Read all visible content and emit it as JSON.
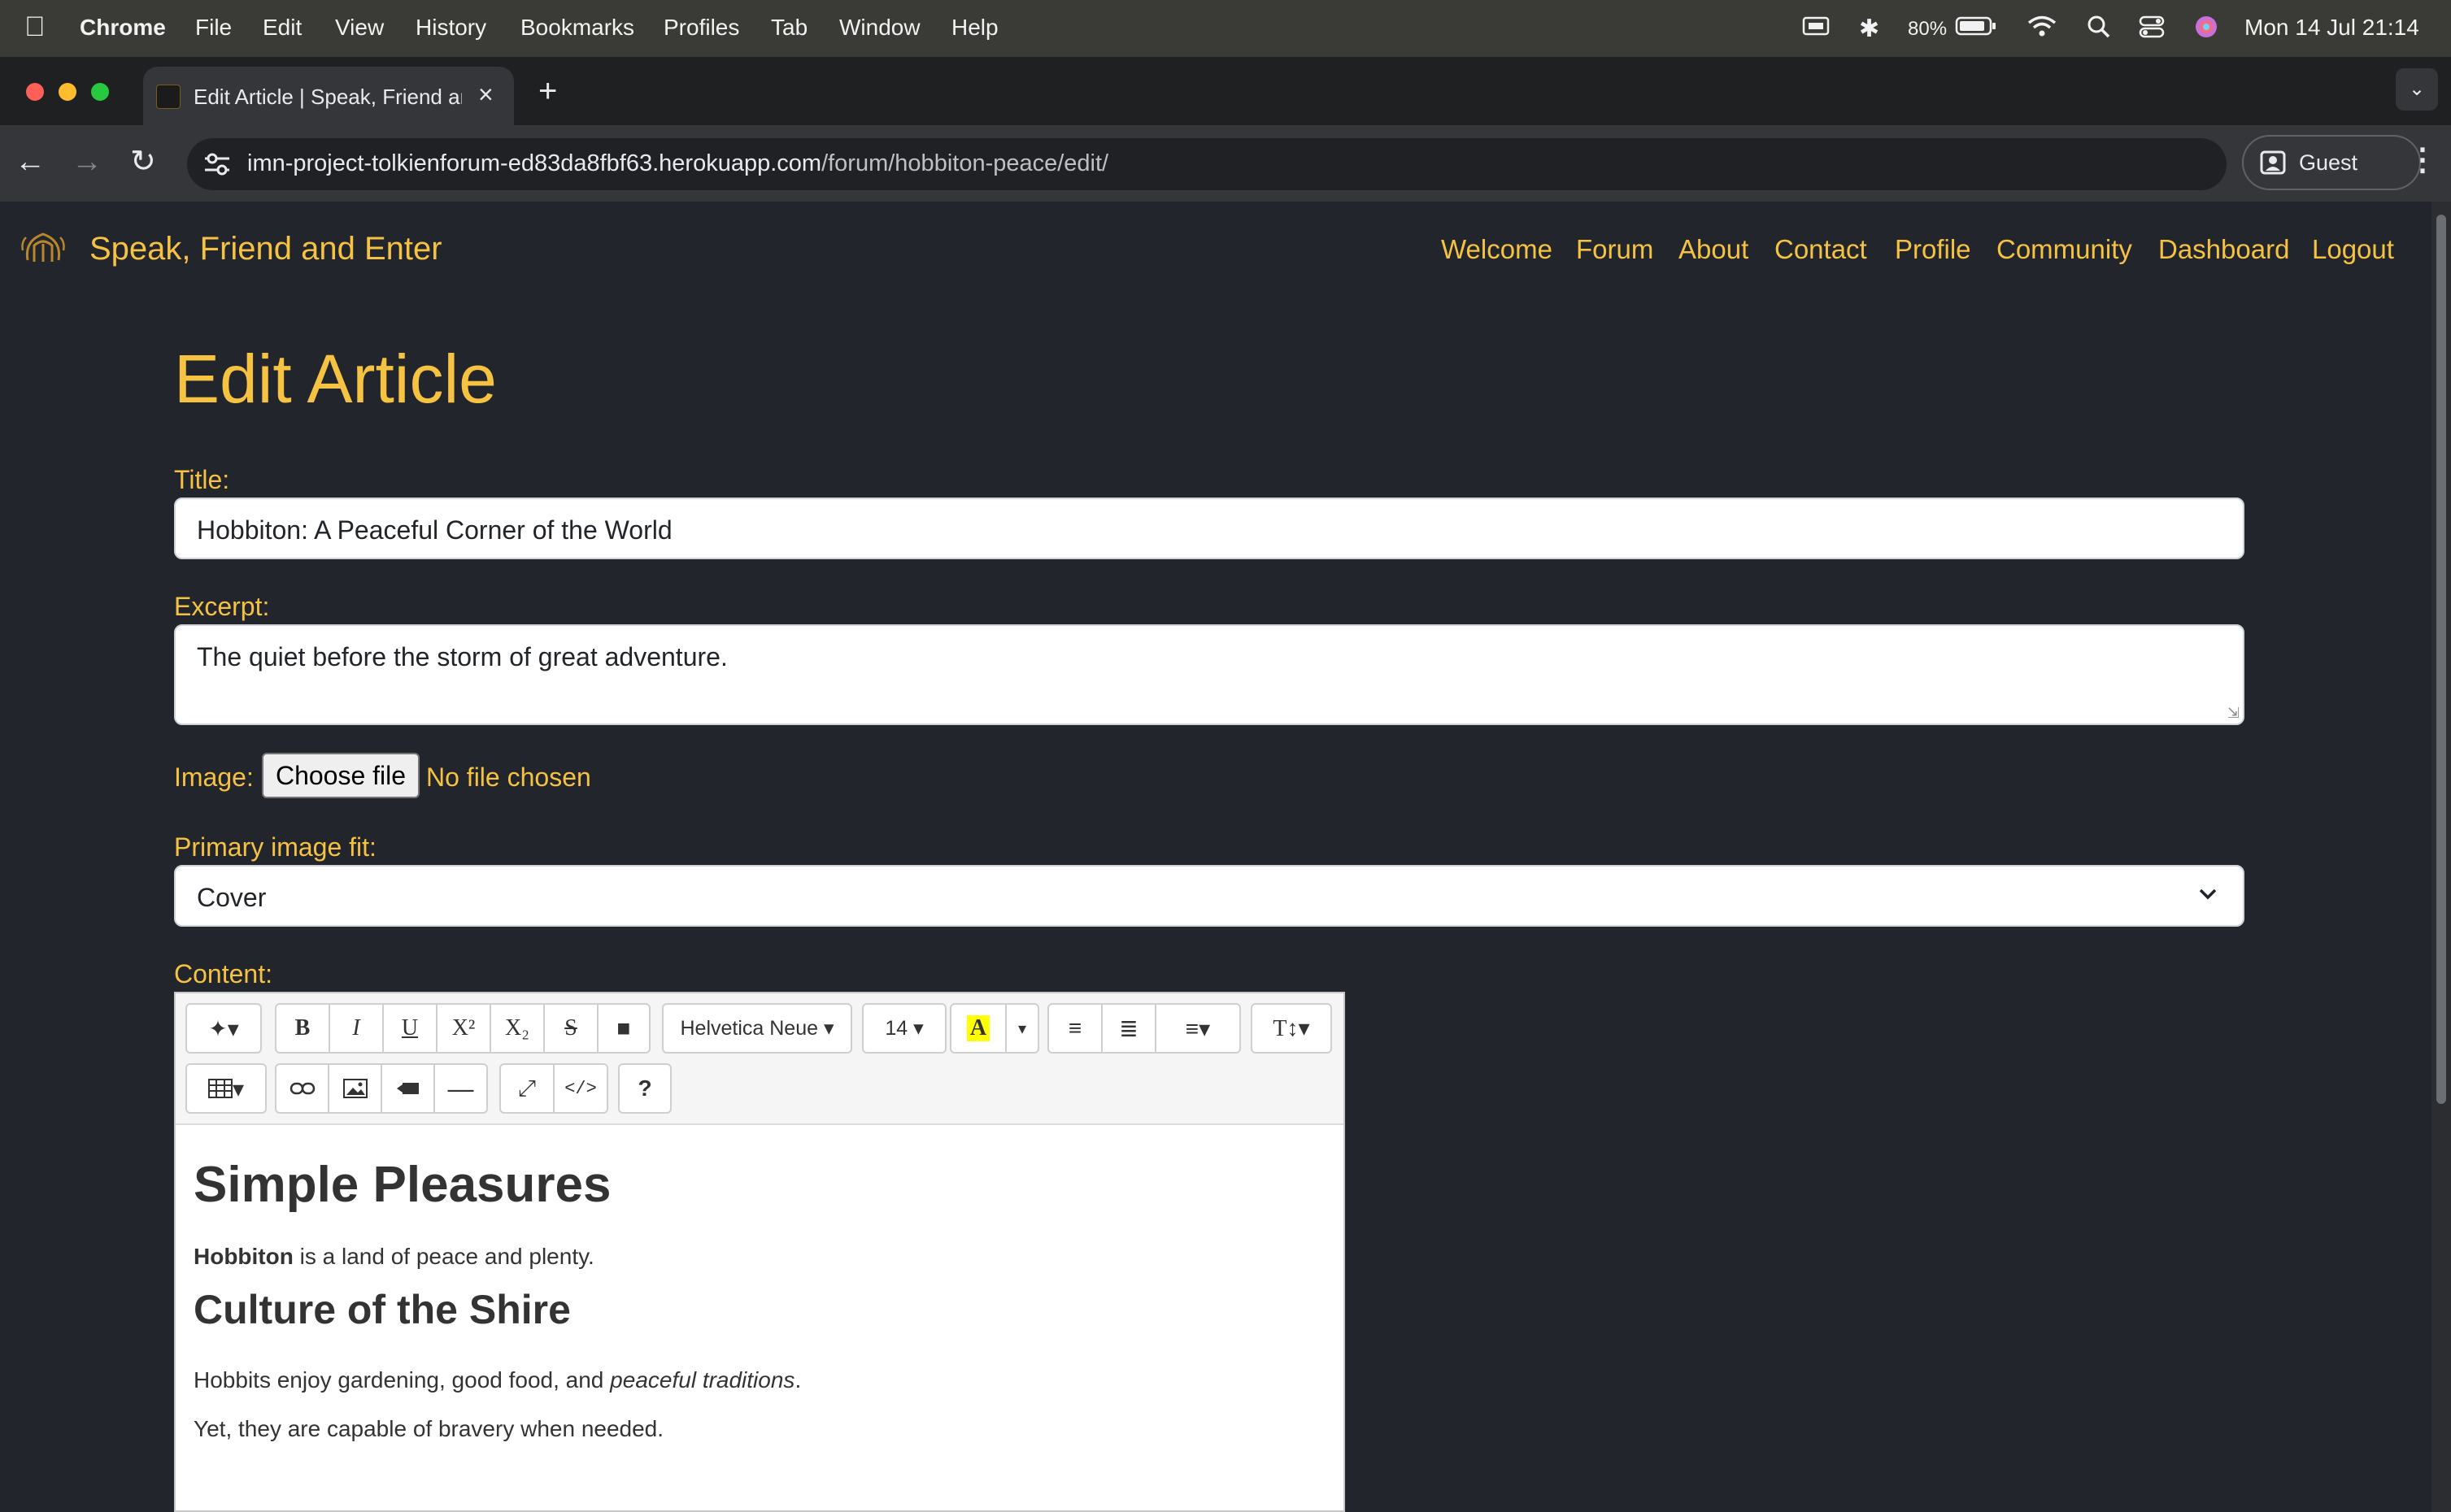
{
  "menubar": {
    "app": "Chrome",
    "items": [
      "File",
      "Edit",
      "View",
      "History",
      "Bookmarks",
      "Profiles",
      "Tab",
      "Window",
      "Help"
    ],
    "battery": "80%",
    "datetime": "Mon 14 Jul  21:14"
  },
  "browser": {
    "tab_title": "Edit Article | Speak, Friend an",
    "url_host": "imn-project-tolkienforum-ed83da8fbf63.herokuapp.com",
    "url_path": "/forum/hobbiton-peace/edit/",
    "profile": "Guest"
  },
  "site": {
    "brand": "Speak, Friend and Enter",
    "nav": [
      "Welcome",
      "Forum",
      "About",
      "Contact",
      "Profile",
      "Community",
      "Dashboard",
      "Logout"
    ]
  },
  "form": {
    "heading": "Edit Article",
    "title_label": "Title:",
    "title_value": "Hobbiton: A Peaceful Corner of the World",
    "excerpt_label": "Excerpt:",
    "excerpt_value": "The quiet before the storm of great adventure.",
    "image_label": "Image:",
    "choose_file": "Choose file",
    "no_file": "No file chosen",
    "fit_label": "Primary image fit:",
    "fit_value": "Cover",
    "content_label": "Content:"
  },
  "editor": {
    "font_name": "Helvetica Neue",
    "font_size": "14",
    "content": {
      "h1": "Simple Pleasures",
      "p1_bold": "Hobbiton",
      "p1_rest": " is a land of peace and plenty.",
      "h2": "Culture of the Shire",
      "p2_start": "Hobbits enjoy gardening, good food, and ",
      "p2_italic": "peaceful traditions",
      "p2_end": ".",
      "p3": "Yet, they are capable of bravery when needed."
    }
  },
  "colors": {
    "accent": "#f5c242",
    "page_bg": "#22252b"
  }
}
